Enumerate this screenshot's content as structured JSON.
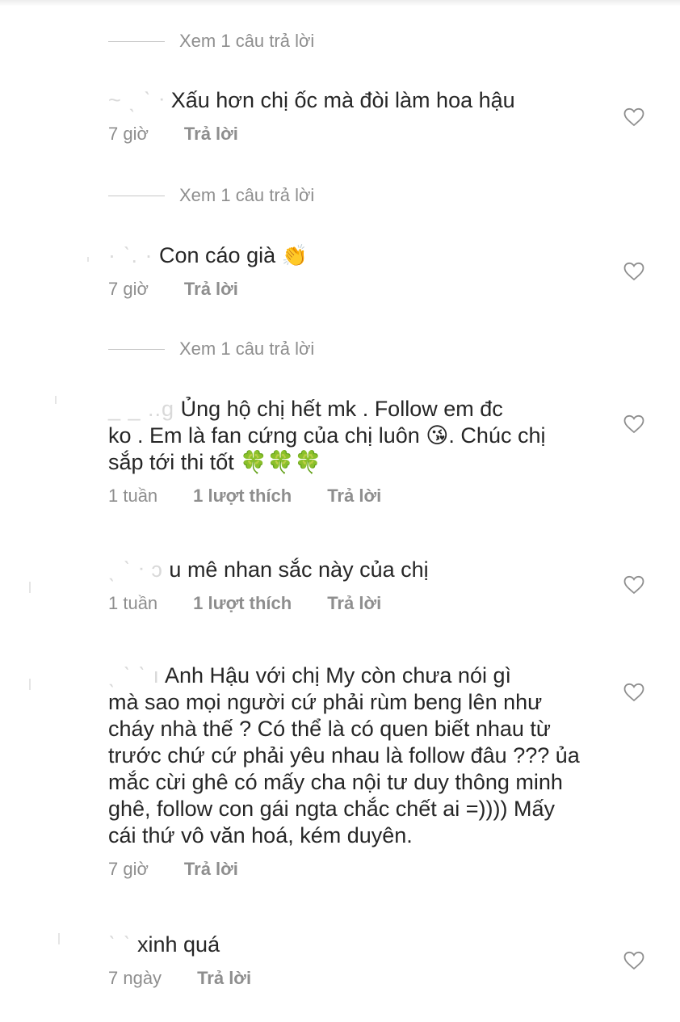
{
  "view_replies_label": "Xem 1 câu trả lời",
  "comments": [
    {
      "username": "~ ˎ ˋ ᐧ",
      "text": "Xấu hơn chị ốc mà đòi làm hoa hậu",
      "time": "7 giờ",
      "likes": "",
      "reply_label": "Trả lời"
    },
    {
      "username": "· ˋ. ·",
      "text": "Con cáo già",
      "emoji": "👏",
      "time": "7 giờ",
      "likes": "",
      "reply_label": "Trả lời"
    },
    {
      "username": "_ _ ..g",
      "text_lines": [
        "Ủng hộ chị hết mk . Follow em đc",
        "ko . Em là fan cứng của chị luôn 😘. Chúc chị",
        "sắp tới thi tốt 🍀🍀🍀"
      ],
      "time": "1 tuần",
      "likes": "1 lượt thích",
      "reply_label": "Trả lời"
    },
    {
      "username": "ˎ ˋ ᐧ ɔ",
      "text": "u mê nhan sắc này của chị",
      "time": "1 tuần",
      "likes": "1 lượt thích",
      "reply_label": "Trả lời"
    },
    {
      "username": "ˎ ˋ ˋ ı",
      "text_lines": [
        "Anh Hậu với chị My còn chưa nói gì",
        "mà sao mọi người cứ phải rùm beng lên như",
        "cháy nhà thế ? Có thể là có quen biết nhau từ",
        "trước chứ cứ phải yêu nhau là follow đâu ??? ủa",
        "mắc cừi ghê có mấy cha nội tư duy thông minh",
        "ghê, follow con gái ngta chắc chết ai =)))) Mấy",
        "cái thứ vô văn hoá, kém duyên."
      ],
      "time": "7 giờ",
      "likes": "",
      "reply_label": "Trả lời"
    },
    {
      "username": "ˋ ˋ",
      "text": "xinh quá",
      "time": "7 ngày",
      "likes": "",
      "reply_label": "Trả lời"
    }
  ],
  "icons": {
    "like": "heart-outline-icon"
  },
  "colors": {
    "text": "#262626",
    "muted": "#8e8e8e",
    "divider": "#c7c7c7"
  }
}
